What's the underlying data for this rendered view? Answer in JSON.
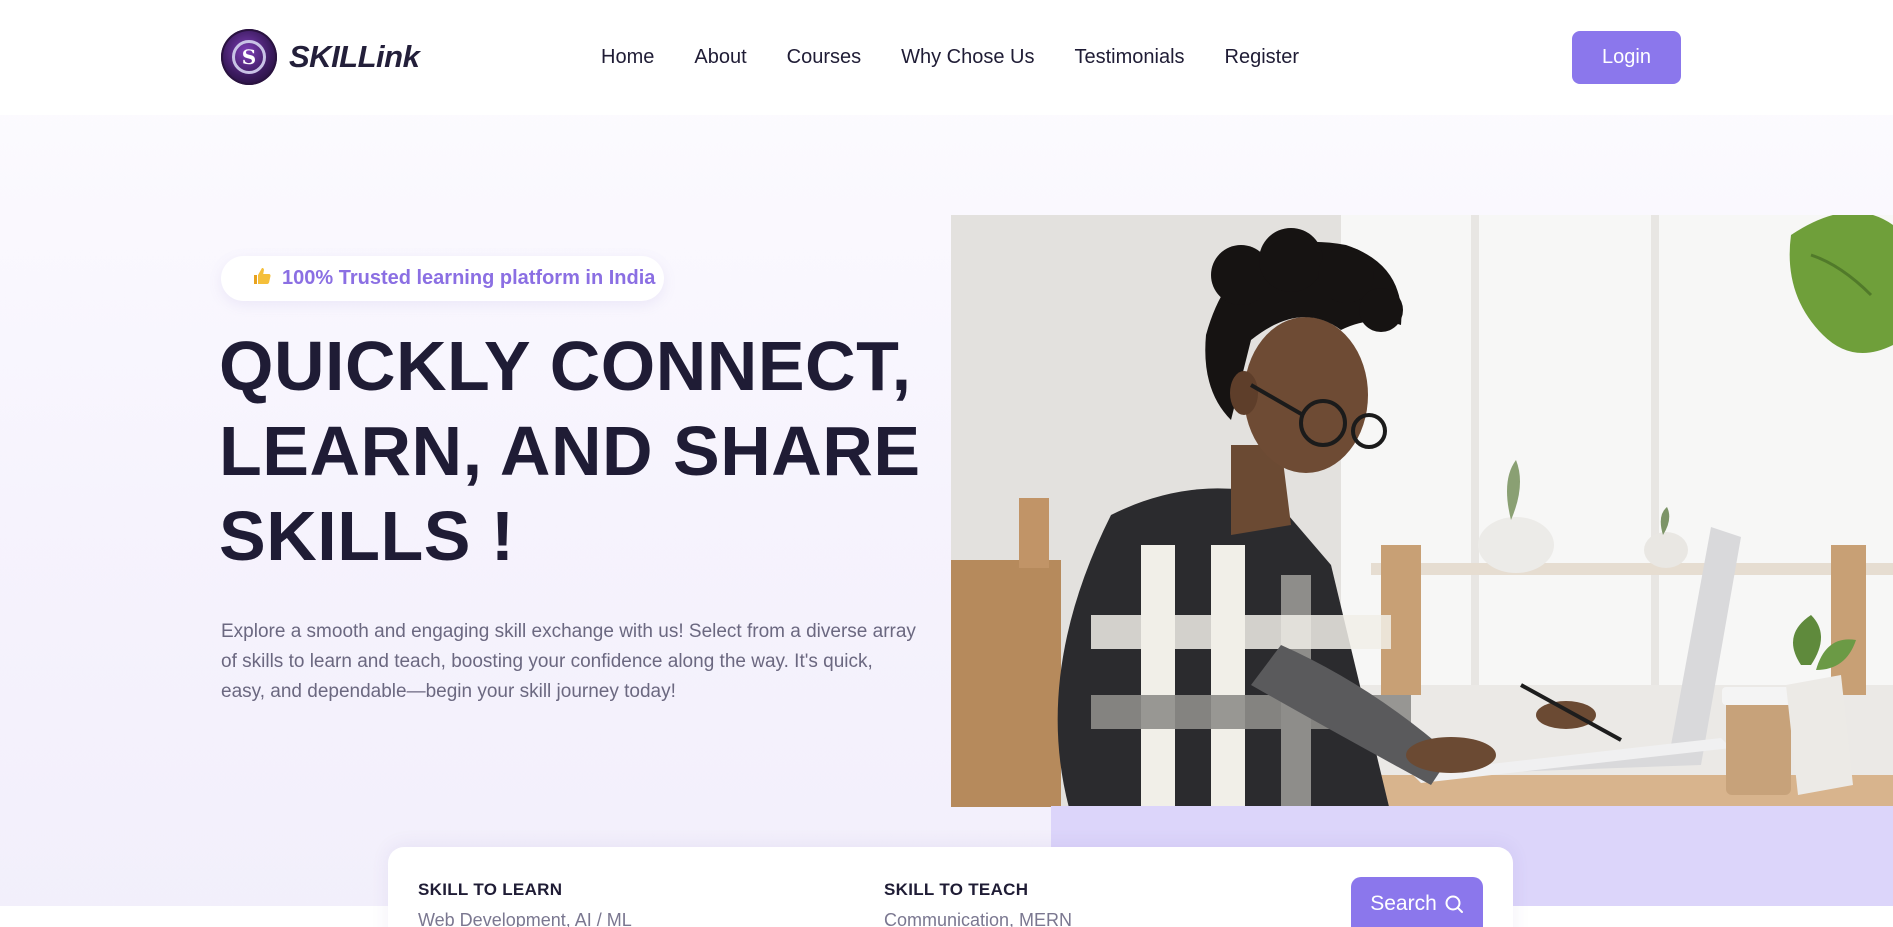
{
  "brand": {
    "name": "SKILLink",
    "logo_letter": "S"
  },
  "nav": {
    "links": [
      "Home",
      "About",
      "Courses",
      "Why Chose Us",
      "Testimonials",
      "Register"
    ],
    "login_label": "Login"
  },
  "hero": {
    "badge_icon": "thumbs-up-icon",
    "badge_text": "100% Trusted learning platform in India",
    "title_lines": [
      "QUICKLY CONNECT,",
      "LEARN, AND SHARE",
      "SKILLS !"
    ],
    "description": "Explore a smooth and engaging skill exchange with us! Select from a diverse array of skills to learn and teach, boosting your confidence along the way. It's quick, easy, and dependable—begin your skill journey today!"
  },
  "search": {
    "learn_label": "SKILL TO LEARN",
    "learn_placeholder": "Web Development, AI / ML",
    "teach_label": "SKILL TO TEACH",
    "teach_placeholder": "Communication, MERN",
    "button_label": "Search",
    "button_icon": "search-icon"
  },
  "colors": {
    "accent": "#8b77ec",
    "badge_text": "#8b6fe3",
    "heading": "#1f1c35",
    "muted": "#6b6880",
    "purple_block": "#dcd5fa"
  }
}
